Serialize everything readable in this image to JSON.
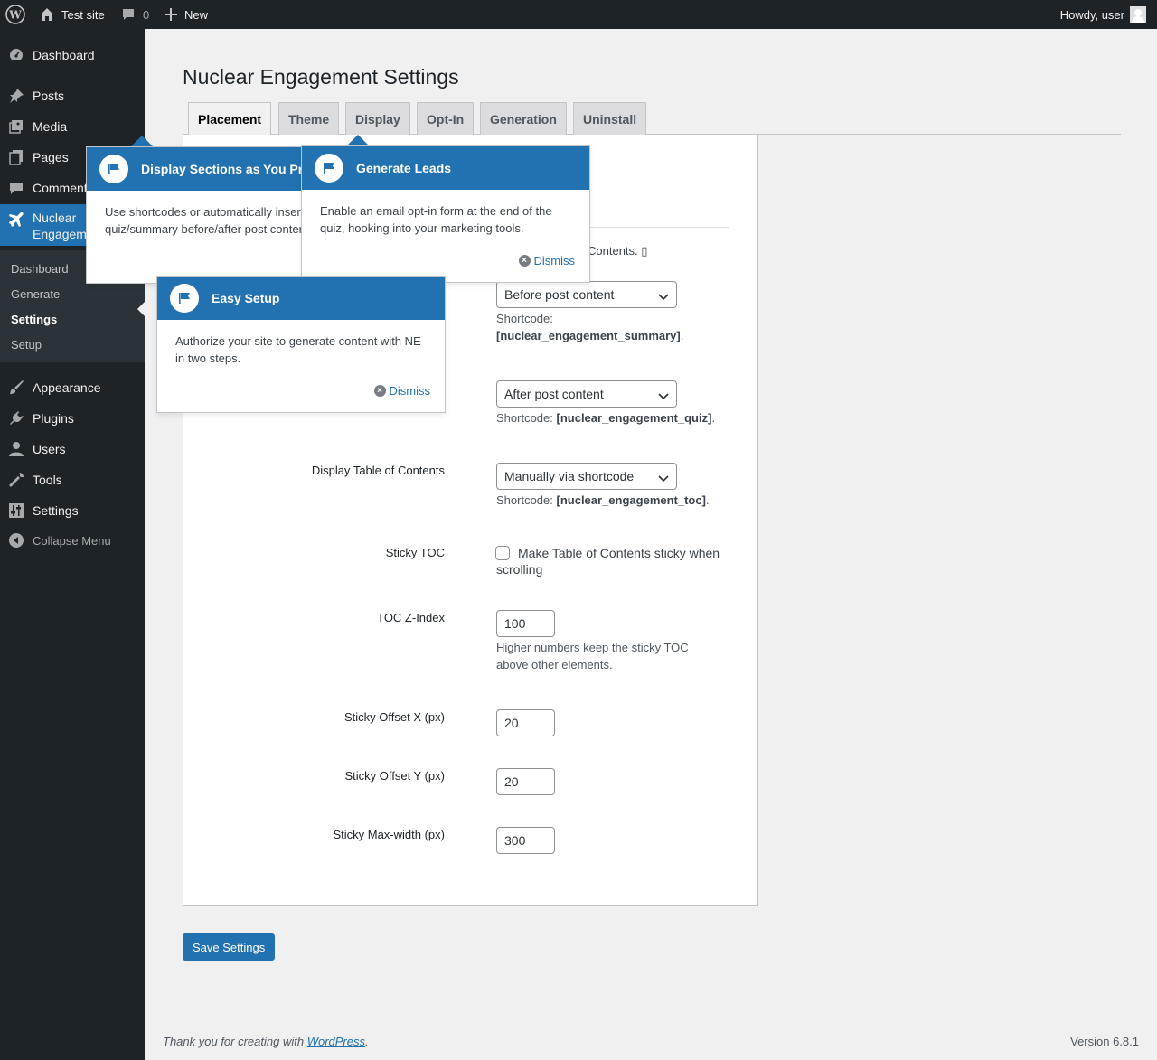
{
  "adminbar": {
    "site_name": "Test site",
    "comments_count": "0",
    "new_label": "New",
    "howdy": "Howdy, user"
  },
  "sidebar": {
    "items": [
      {
        "label": "Dashboard",
        "icon": "dashboard-icon"
      },
      {
        "label": "Posts",
        "icon": "pin-icon"
      },
      {
        "label": "Media",
        "icon": "media-icon"
      },
      {
        "label": "Pages",
        "icon": "pages-icon"
      },
      {
        "label": "Comments",
        "icon": "comment-icon"
      },
      {
        "label": "Nuclear Engagement",
        "icon": "plane-icon"
      },
      {
        "label": "Appearance",
        "icon": "brush-icon"
      },
      {
        "label": "Plugins",
        "icon": "plug-icon"
      },
      {
        "label": "Users",
        "icon": "user-icon"
      },
      {
        "label": "Tools",
        "icon": "wrench-icon"
      },
      {
        "label": "Settings",
        "icon": "sliders-icon"
      }
    ],
    "active_label_line1": "Nuclear",
    "active_label_line2": "Engagem",
    "comments_label_visible": "Comment",
    "submenu": [
      "Dashboard",
      "Generate",
      "Settings",
      "Setup"
    ],
    "collapse_label": "Collapse Menu"
  },
  "page": {
    "title": "Nuclear Engagement Settings",
    "tabs": [
      "Placement",
      "Theme",
      "Display",
      "Opt-In",
      "Generation",
      "Uninstall"
    ],
    "partial_text": "Contents. ▯",
    "summary": {
      "select": "Before post content",
      "desc_prefix": "Shortcode:",
      "shortcode": "[nuclear_engagement_summary]"
    },
    "quiz": {
      "select": "After post content",
      "desc_prefix": "Shortcode:",
      "shortcode": "[nuclear_engagement_quiz]"
    },
    "toc": {
      "label": "Display Table of Contents",
      "select": "Manually via shortcode",
      "desc_prefix": "Shortcode:",
      "shortcode": "[nuclear_engagement_toc]"
    },
    "sticky_toc": {
      "label": "Sticky TOC",
      "checkbox_label": "Make Table of Contents sticky when scrolling"
    },
    "toc_zindex": {
      "label": "TOC Z-Index",
      "value": "100",
      "desc": "Higher numbers keep the sticky TOC above other elements."
    },
    "offset_x": {
      "label": "Sticky Offset X (px)",
      "value": "20"
    },
    "offset_y": {
      "label": "Sticky Offset Y (px)",
      "value": "20"
    },
    "max_width": {
      "label": "Sticky Max-width (px)",
      "value": "300"
    },
    "save_label": "Save Settings"
  },
  "pointers": {
    "display": {
      "title": "Display Sections as You Pr",
      "body": "Use shortcodes or automatically inser quiz/summary before/after post conter"
    },
    "leads": {
      "title": "Generate Leads",
      "body": "Enable an email opt-in form at the end of the quiz, hooking into your marketing tools.",
      "dismiss": "Dismiss"
    },
    "setup": {
      "title": "Easy Setup",
      "body": "Authorize your site to generate content with NE in two steps.",
      "dismiss": "Dismiss"
    }
  },
  "footer": {
    "thanks_prefix": "Thank you for creating with ",
    "wp_link": "WordPress",
    "thanks_suffix": ".",
    "version": "Version 6.8.1"
  },
  "colors": {
    "accent": "#2271b1",
    "sidebar_bg": "#1d2327",
    "submenu_bg": "#2c3338"
  }
}
